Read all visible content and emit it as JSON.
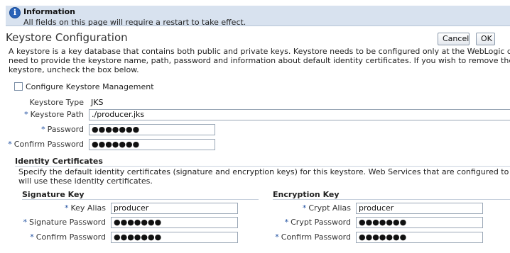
{
  "info": {
    "title": "Information",
    "message": "All fields on this page will require a restart to take effect."
  },
  "page": {
    "title": "Keystore Configuration",
    "cancel_label": "Cancel",
    "ok_label": "OK",
    "description_lines": [
      "A keystore is a key database that contains both public and private keys. Keystore needs to be configured only at the WebLogic domain level. You would",
      "need to provide the keystore name, path, password and information about default identity certificates. If you wish to remove the configuration of the",
      "keystore, uncheck the box below."
    ]
  },
  "keystore": {
    "configure_label": "Configure Keystore Management",
    "configure_checked": false,
    "type_label": "Keystore Type",
    "type_value": "JKS",
    "path_label": "Keystore Path",
    "path_value": "./producer.jks",
    "password_label": "Password",
    "password_value": "●●●●●●●",
    "confirm_label": "Confirm Password",
    "confirm_value": "●●●●●●●",
    "required_marker": "*"
  },
  "identity": {
    "title": "Identity Certificates",
    "description_lines": [
      "Specify the default identity certificates (signature and encryption keys) for this keystore. Web Services that are configured to use this keystore",
      "will use these identity certificates."
    ],
    "signature": {
      "title": "Signature Key",
      "alias_label": "Key Alias",
      "alias_value": "producer",
      "password_label": "Signature Password",
      "password_value": "●●●●●●●",
      "confirm_label": "Confirm Password",
      "confirm_value": "●●●●●●●"
    },
    "encryption": {
      "title": "Encryption Key",
      "alias_label": "Crypt Alias",
      "alias_value": "producer",
      "password_label": "Crypt Password",
      "password_value": "●●●●●●●",
      "confirm_label": "Confirm Password",
      "confirm_value": "●●●●●●●"
    }
  }
}
